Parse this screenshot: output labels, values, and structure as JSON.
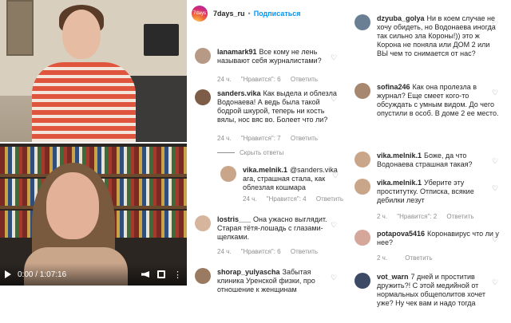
{
  "post": {
    "username": "7days_ru",
    "follow_label": "Подписаться",
    "separator": "•",
    "logo_text": "7days"
  },
  "video": {
    "time": "0:00 / 1:07:16"
  },
  "comments_mid": [
    {
      "user": "lanamark91",
      "text": "Все кому не лень называют себя журналистами?",
      "time": "24 ч.",
      "likes": "\"Нравится\": 6",
      "reply": "Ответить"
    },
    {
      "user": "sanders.vika",
      "text": "Как выдела и облезла Водонаева! А ведь была такой бодрой шкурой, теперь ни кость вялы, нос вяс во. Болеет что ли?",
      "time": "24 ч.",
      "likes": "\"Нравится\": 7",
      "reply": "Ответить",
      "hide_label": "Скрыть ответы"
    },
    {
      "user": "vika.melnik.1",
      "text": "@sanders.vika ага, страшная стала, как облезлая кошмара",
      "time": "24 ч.",
      "likes": "\"Нравится\": 4",
      "reply": "Ответить"
    },
    {
      "user": "lostris___",
      "text": "Она ужасно выглядит. Старая тётя-лошадь с глазами-щелками.",
      "time": "24 ч.",
      "likes": "\"Нравится\": 6",
      "reply": "Ответить"
    },
    {
      "user": "shorap_yulyascha",
      "text": "Забытая клиника Уренской физки, про отношение к женщинам",
      "time": "",
      "likes": "",
      "reply": ""
    }
  ],
  "comments_right": [
    {
      "user": "dzyuba_golya",
      "text": "Ни в коем случае не хочу обидеть, но Водонаева иногда так сильно зла Короны!)) это ж Корона не поняла или ДОМ 2 или ВЫ чем то снимается от нас?",
      "time": "",
      "likes": "",
      "reply": ""
    },
    {
      "user": "sofina246",
      "text": "Как она пролезла в журнал? Еще смеет кого-то обсуждать с умным видом. До чего опустили в особ. В доме 2 ее место.",
      "time": "",
      "likes": "",
      "reply": ""
    },
    {
      "user": "vika.melnik.1",
      "text": "Боже, да что Водонаева страшная такая?",
      "time": "",
      "likes": "",
      "reply": ""
    },
    {
      "user": "vika.melnik.1",
      "text": "Уберите эту проститутку. Отписка, всякие дебилки лезут",
      "time": "2 ч.",
      "likes": "\"Нравится\": 2",
      "reply": "Ответить"
    },
    {
      "user": "potapova5416",
      "text": "Коронавирус что ли у нее?",
      "time": "2 ч.",
      "likes": "",
      "reply": "Ответить"
    },
    {
      "user": "vot_warn",
      "text": "7 дней и проститив дружить?! С этой медийной от нормальных общеполитов хочет уже? Ну чек вам и надо тогда",
      "time": "",
      "likes": "",
      "reply": ""
    }
  ]
}
